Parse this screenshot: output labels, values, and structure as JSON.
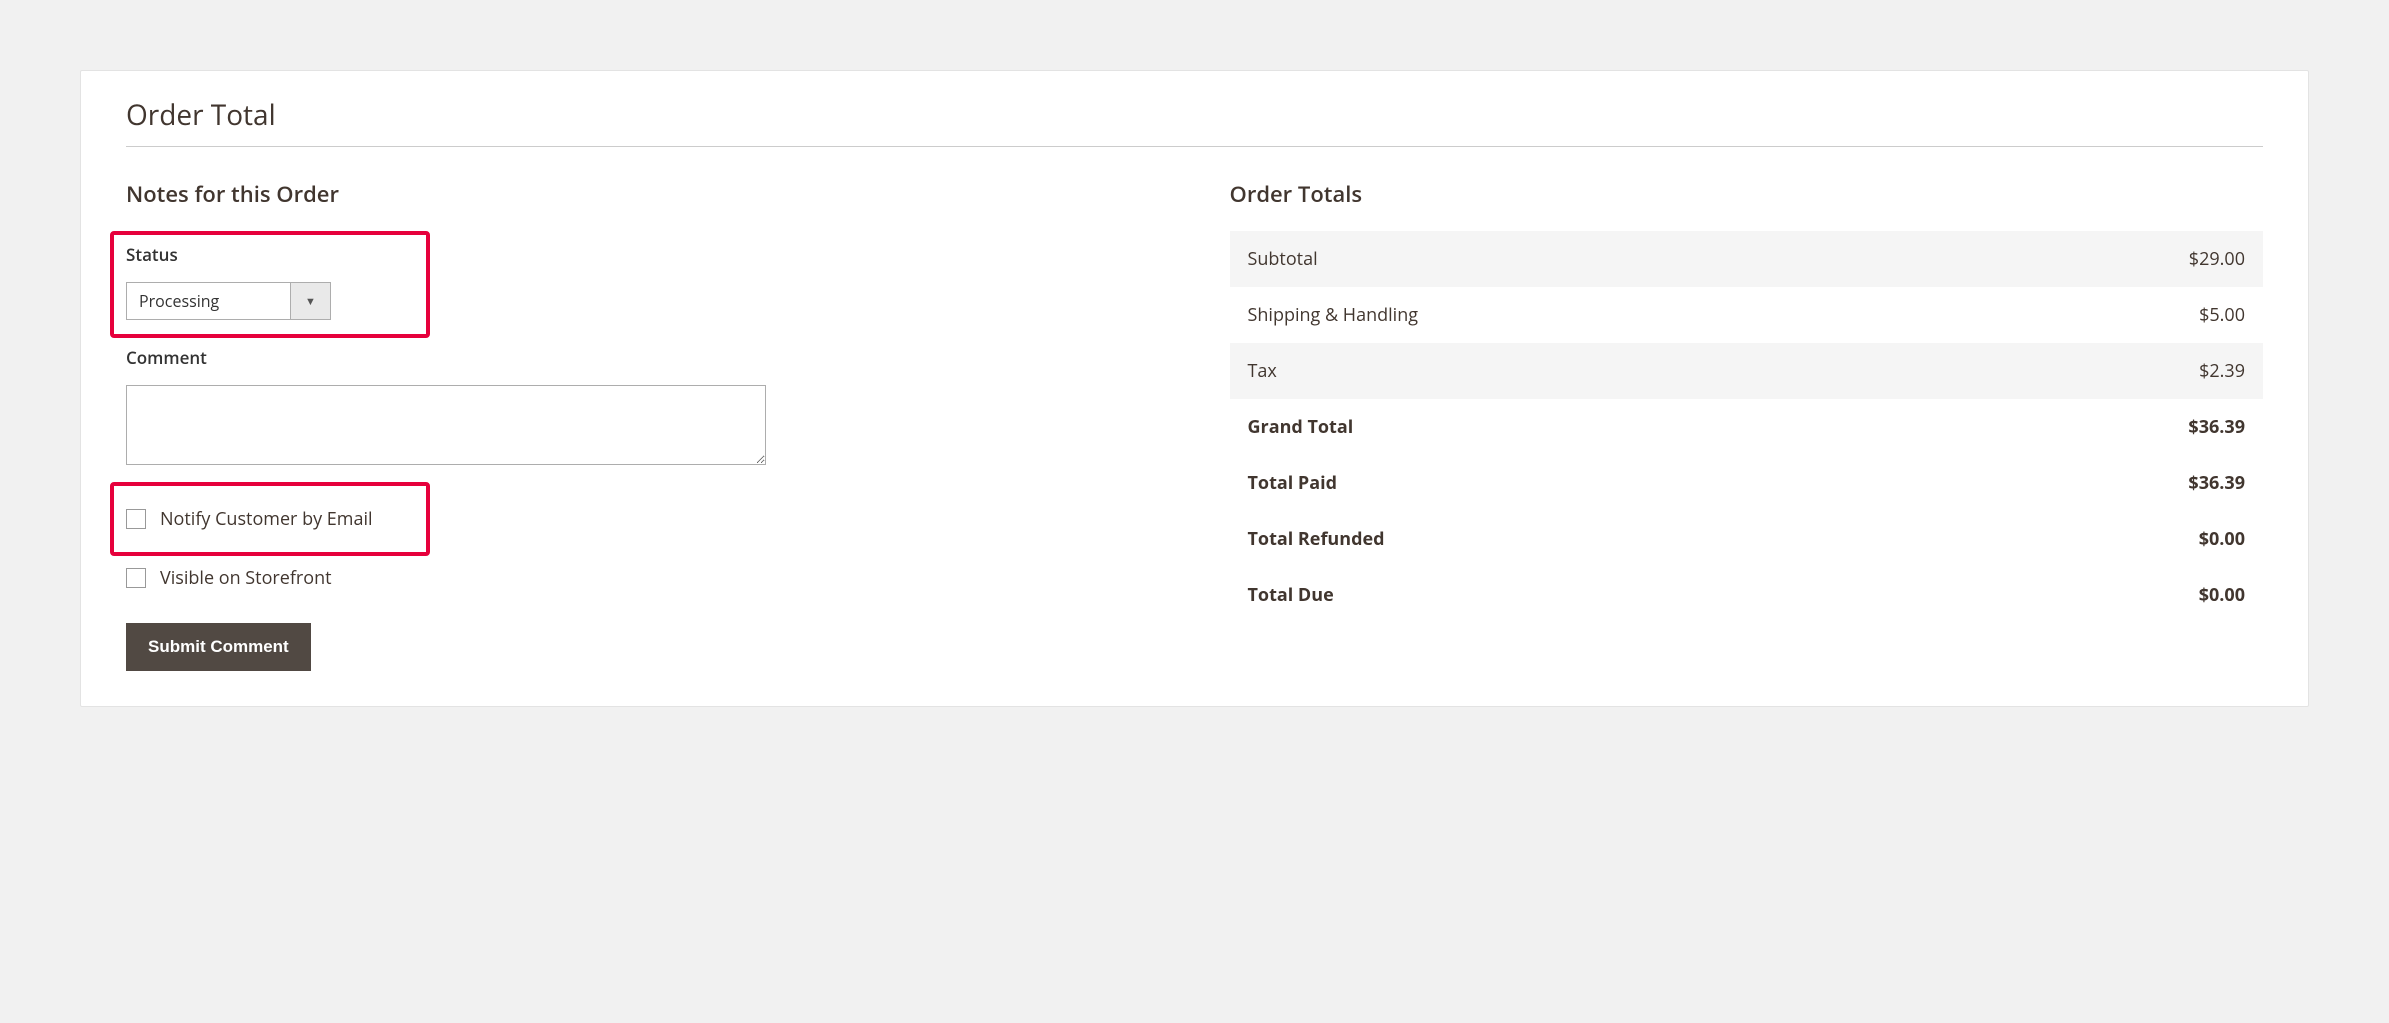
{
  "panel": {
    "title": "Order Total"
  },
  "notes": {
    "heading": "Notes for this Order",
    "status_label": "Status",
    "status_value": "Processing",
    "comment_label": "Comment",
    "comment_value": "",
    "notify_label": "Notify Customer by Email",
    "visible_label": "Visible on Storefront",
    "submit_label": "Submit Comment"
  },
  "totals": {
    "heading": "Order Totals",
    "rows": [
      {
        "label": "Subtotal",
        "value": "$29.00",
        "stripe": true,
        "bold": false
      },
      {
        "label": "Shipping & Handling",
        "value": "$5.00",
        "stripe": false,
        "bold": false
      },
      {
        "label": "Tax",
        "value": "$2.39",
        "stripe": true,
        "bold": false
      },
      {
        "label": "Grand Total",
        "value": "$36.39",
        "stripe": false,
        "bold": true
      },
      {
        "label": "Total Paid",
        "value": "$36.39",
        "stripe": false,
        "bold": true
      },
      {
        "label": "Total Refunded",
        "value": "$0.00",
        "stripe": false,
        "bold": true
      },
      {
        "label": "Total Due",
        "value": "$0.00",
        "stripe": false,
        "bold": true
      }
    ]
  }
}
